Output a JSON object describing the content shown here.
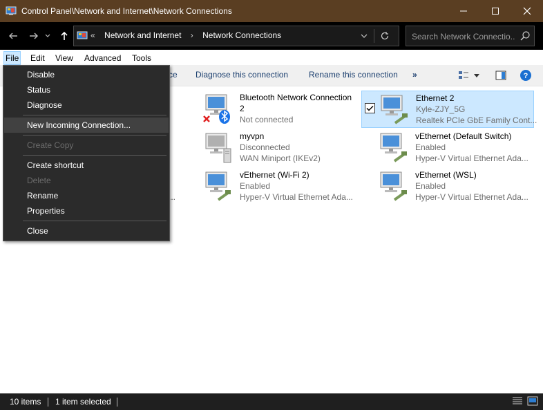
{
  "window": {
    "title": "Control Panel\\Network and Internet\\Network Connections",
    "controls": [
      "minimize-icon",
      "maximize-icon",
      "close-icon"
    ]
  },
  "address": {
    "overflow": "«",
    "crumbs": [
      "Network and Internet",
      "Network Connections"
    ]
  },
  "search": {
    "placeholder": "Search Network Connectio..."
  },
  "menu": {
    "items": [
      "File",
      "Edit",
      "View",
      "Advanced",
      "Tools"
    ],
    "active": "File"
  },
  "commands": {
    "partial": "ce",
    "diagnose": "Diagnose this connection",
    "rename": "Rename this connection",
    "more": "»"
  },
  "file_menu": [
    {
      "label": "Disable",
      "enabled": true
    },
    {
      "label": "Status",
      "enabled": true
    },
    {
      "label": "Diagnose",
      "enabled": true
    },
    {
      "label": "New Incoming Connection...",
      "enabled": true,
      "highlighted": true
    },
    {
      "label": "Create Copy",
      "enabled": false
    },
    {
      "label": "Create shortcut",
      "enabled": true
    },
    {
      "label": "Delete",
      "enabled": false
    },
    {
      "label": "Rename",
      "enabled": true
    },
    {
      "label": "Properties",
      "enabled": true
    },
    {
      "label": "Close",
      "enabled": true
    }
  ],
  "connections": [
    {
      "name": "Bluetooth Network Connection 2",
      "line1": "Bluetooth Network Connection",
      "line2": "2",
      "status": "Not connected",
      "device": "",
      "icon": "bluetooth-connection-icon"
    },
    {
      "name": "Ethernet 2",
      "status": "Kyle-ZJY_5G",
      "device": "Realtek PCIe GbE Family Cont...",
      "icon": "ethernet-connection-icon",
      "selected": true
    },
    {
      "name": "myvpn",
      "status": "Disconnected",
      "device": "WAN Miniport (IKEv2)",
      "icon": "vpn-connection-icon"
    },
    {
      "name": "vEthernet (Default Switch)",
      "status": "Enabled",
      "device": "Hyper-V Virtual Ethernet Ada...",
      "icon": "ethernet-connection-icon"
    },
    {
      "name": "vEthernet (Wi-Fi 2)",
      "status": "Enabled",
      "device": "Hyper-V Virtual Ethernet Ada...",
      "icon": "ethernet-connection-icon"
    },
    {
      "name": "vEthernet (WSL)",
      "status": "Enabled",
      "device": "Hyper-V Virtual Ethernet Ada...",
      "icon": "ethernet-connection-icon"
    }
  ],
  "partial_left": "...",
  "status": {
    "items": "10 items",
    "selected": "1 item selected"
  },
  "colors": {
    "titlebar": "#5a3e22",
    "addressbar": "#000000",
    "menu_bg": "#2b2b2b",
    "selection": "#cce8ff",
    "statusbar": "#1f1f1f"
  }
}
